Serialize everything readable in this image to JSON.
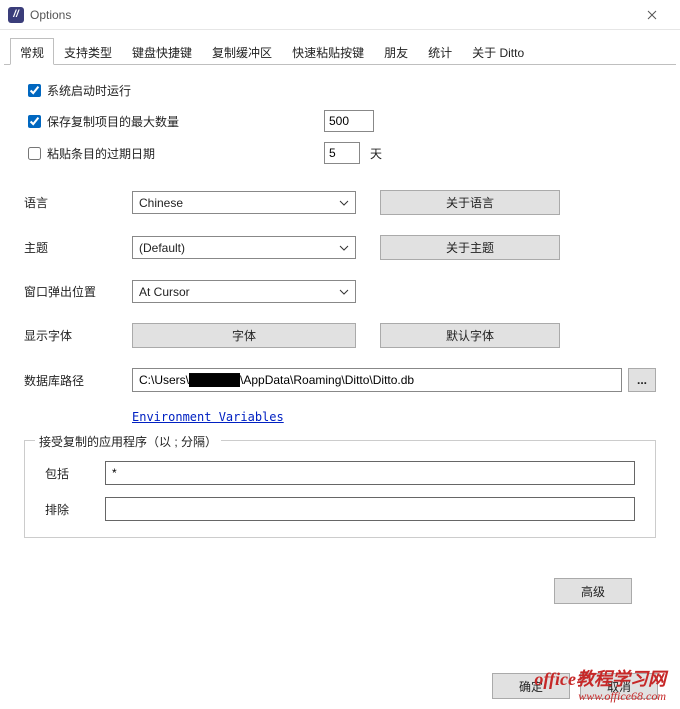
{
  "window": {
    "title": "Options",
    "icon_glyph": "//"
  },
  "tabs": [
    "常规",
    "支持类型",
    "键盘快捷键",
    "复制缓冲区",
    "快速粘贴按键",
    "朋友",
    "统计",
    "关于 Ditto"
  ],
  "general": {
    "run_on_startup": {
      "label": "系统启动时运行",
      "checked": true
    },
    "max_copies": {
      "label": "保存复制项目的最大数量",
      "checked": true,
      "value": "500"
    },
    "expire": {
      "label": "粘贴条目的过期日期",
      "checked": false,
      "value": "5",
      "unit": "天"
    },
    "language": {
      "label": "语言",
      "value": "Chinese",
      "about_btn": "关于语言"
    },
    "theme": {
      "label": "主题",
      "value": "(Default)",
      "about_btn": "关于主题"
    },
    "popup": {
      "label": "窗口弹出位置",
      "value": "At Cursor"
    },
    "font": {
      "label": "显示字体",
      "font_btn": "字体",
      "default_btn": "默认字体"
    },
    "db": {
      "label": "数据库路径",
      "value": "C:\\Users\\██████\\AppData\\Roaming\\Ditto\\Ditto.db",
      "envvars": "Environment Variables"
    },
    "apps": {
      "title": "接受复制的应用程序（以 ; 分隔）",
      "include_label": "包括",
      "include_value": "*",
      "exclude_label": "排除",
      "exclude_value": ""
    },
    "advanced_btn": "高级"
  },
  "dialog": {
    "ok": "确定",
    "cancel": "取消"
  },
  "watermark": {
    "line1": "office教程学习网",
    "line2": "www.office68.com"
  }
}
